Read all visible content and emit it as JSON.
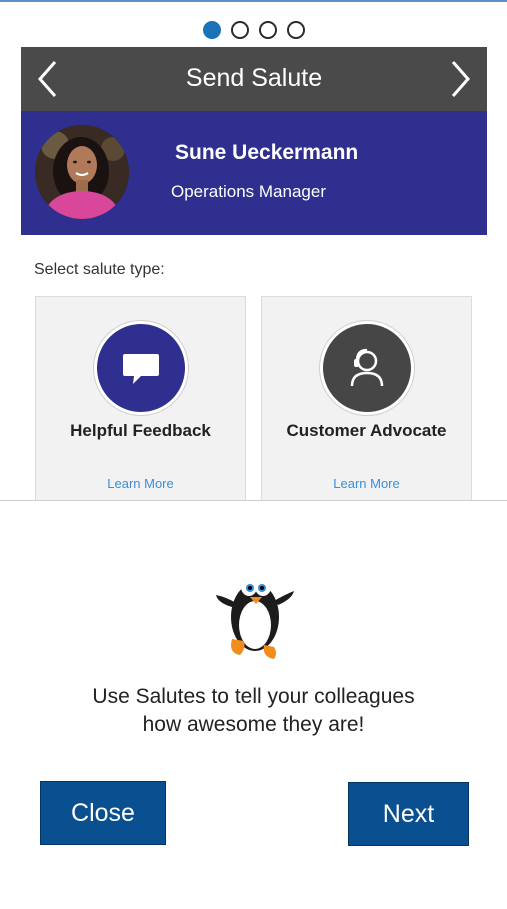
{
  "pagination": {
    "total": 4,
    "active": 0
  },
  "header": {
    "title": "Send Salute",
    "prev_icon": "chevron-left-icon",
    "next_icon": "chevron-right-icon"
  },
  "profile": {
    "name": "Sune Ueckermann",
    "role": "Operations Manager"
  },
  "salute": {
    "select_label": "Select salute type:",
    "types": [
      {
        "title": "Helpful Feedback",
        "link": "Learn More",
        "icon": "speech-bubble-icon",
        "color": "#2e2f8f"
      },
      {
        "title": "Customer Advocate",
        "link": "Learn More",
        "icon": "user-headset-icon",
        "color": "#464646"
      }
    ]
  },
  "intro": {
    "mascot": "penguin-icon",
    "message_line1": "Use Salutes to tell your colleagues",
    "message_line2": "how awesome they are!",
    "close_label": "Close",
    "next_label": "Next"
  },
  "colors": {
    "accent": "#0a4f8f",
    "header_bg": "#4a4a4a",
    "profile_bg": "#2e2f8f",
    "link": "#3b8ed8",
    "active_dot": "#1a73b6"
  }
}
